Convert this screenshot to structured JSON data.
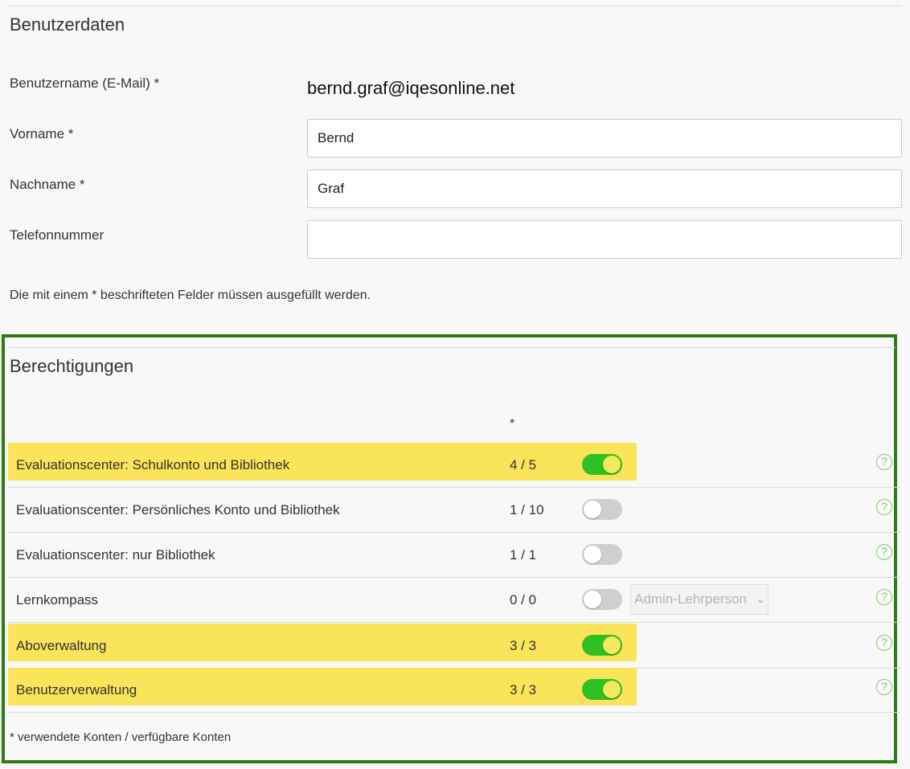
{
  "user_data": {
    "title": "Benutzerdaten",
    "username_label": "Benutzername (E-Mail) *",
    "username_value": "bernd.graf@iqesonline.net",
    "firstname_label": "Vorname *",
    "firstname_value": "Bernd",
    "lastname_label": "Nachname *",
    "lastname_value": "Graf",
    "phone_label": "Telefonnummer",
    "phone_value": "",
    "required_note": "Die mit einem * beschrifteten Felder müssen ausgefüllt werden."
  },
  "permissions": {
    "title": "Berechtigungen",
    "count_header": "*",
    "help_icon": "?",
    "rows": [
      {
        "label": "Evaluationscenter: Schulkonto und Bibliothek",
        "count": "4 / 5",
        "enabled": true,
        "highlighted": true
      },
      {
        "label": "Evaluationscenter: Persönliches Konto und Bibliothek",
        "count": "1 / 10",
        "enabled": false,
        "highlighted": false
      },
      {
        "label": "Evaluationscenter: nur Bibliothek",
        "count": "1 / 1",
        "enabled": false,
        "highlighted": false
      },
      {
        "label": "Lernkompass",
        "count": "0 / 0",
        "enabled": false,
        "highlighted": false,
        "role_select": "Admin-Lehrperson"
      },
      {
        "label": "Aboverwaltung",
        "count": "3 / 3",
        "enabled": true,
        "highlighted": true
      },
      {
        "label": "Benutzerverwaltung",
        "count": "3 / 3",
        "enabled": true,
        "highlighted": true
      }
    ],
    "footnote": "* verwendete Konten / verfügbare Konten"
  },
  "colors": {
    "highlight": "#fae45a",
    "frame": "#2f7a12",
    "toggle_on": "#2fc022",
    "help_icon": "#7fce6a"
  }
}
